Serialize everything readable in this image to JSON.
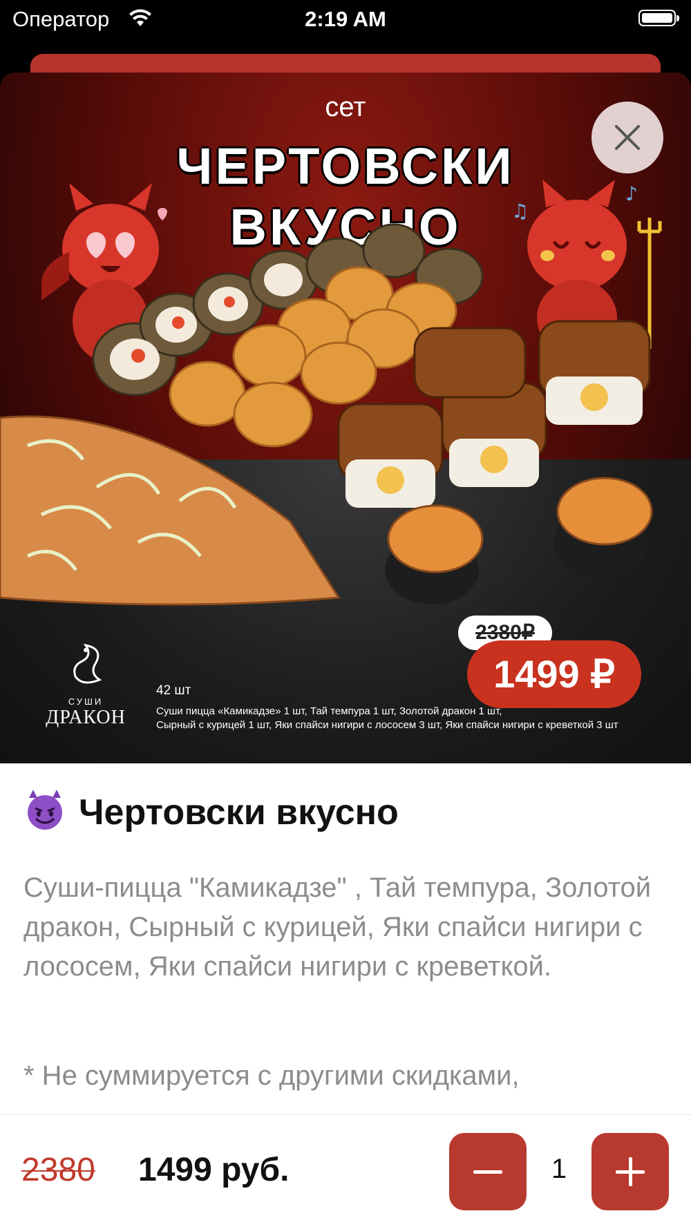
{
  "status_bar": {
    "carrier": "Оператор",
    "time": "2:19 AM"
  },
  "hero": {
    "set_label": "сет",
    "set_title_line1": "Чертовски",
    "set_title_line2": "вкусно",
    "old_price": "2380₽",
    "price": "1499 ₽",
    "pieces": "42 шт",
    "composition_line1": "Суши пицца «Камикадзе» 1 шт, Тай темпура 1 шт, Золотой дракон 1 шт,",
    "composition_line2": "Сырный с курицей 1 шт, Яки спайси нигири с лососем 3 шт, Яки спайси нигири с креветкой 3 шт",
    "brand_small": "СУШИ",
    "brand_big": "ДРАКОН"
  },
  "product": {
    "title": "Чертовски вкусно",
    "description": "Суши-пицца \"Камикадзе\" , Тай темпура, Золотой дракон, Сырный с курицей, Яки спайси нигири с лососем, Яки спайси нигири с креветкой.",
    "note": "* Не суммируется с другими скидками,"
  },
  "bottom_bar": {
    "old_price": "2380",
    "new_price": "1499 руб.",
    "quantity": "1"
  },
  "colors": {
    "accent": "#b83a2e",
    "price_badge": "#c8321f",
    "old_price": "#c0392b"
  }
}
